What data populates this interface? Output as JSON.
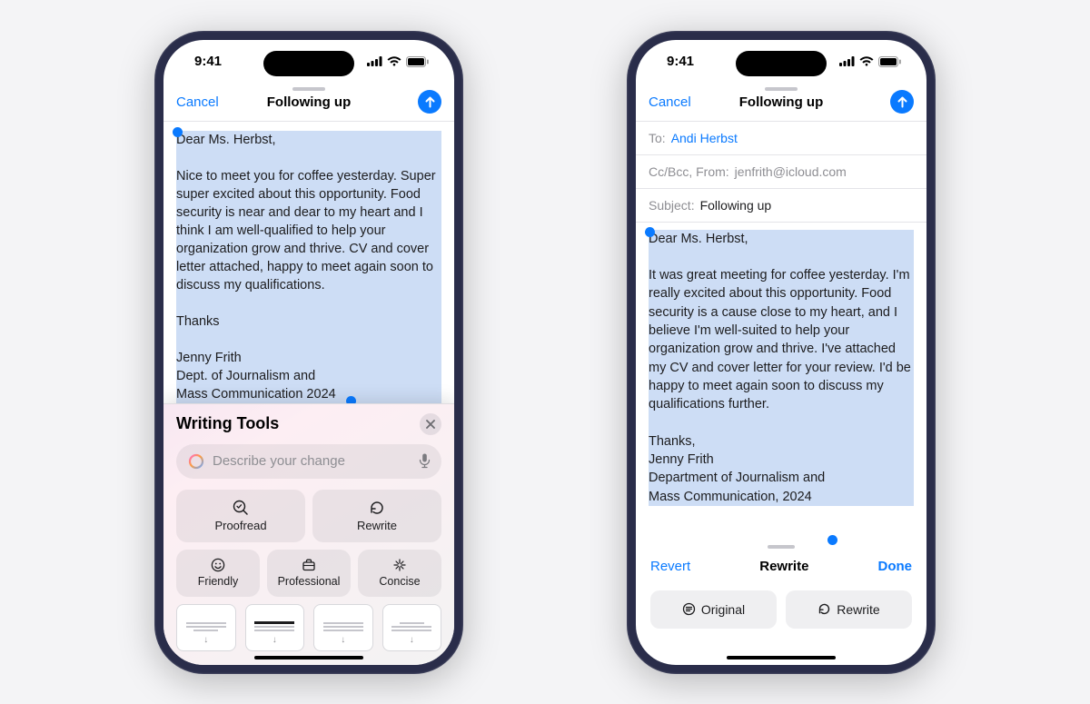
{
  "status": {
    "time": "9:41"
  },
  "nav": {
    "cancel": "Cancel",
    "title": "Following up"
  },
  "phone1": {
    "body": "Dear Ms. Herbst,\n\nNice to meet you for coffee yesterday. Super super excited about this opportunity. Food security is near and dear to my heart and I think I am well-qualified to help your organization grow and thrive. CV and cover letter attached, happy to meet again soon to discuss my qualifications.\n\nThanks\n\nJenny Frith\nDept. of Journalism and\nMass Communication 2024"
  },
  "wt": {
    "title": "Writing Tools",
    "placeholder": "Describe your change",
    "proofread": "Proofread",
    "rewrite": "Rewrite",
    "friendly": "Friendly",
    "professional": "Professional",
    "concise": "Concise"
  },
  "phone2": {
    "to_label": "To:",
    "to_value": "Andi Herbst",
    "ccbcc_label": "Cc/Bcc, From:",
    "ccbcc_value": "jenfrith@icloud.com",
    "subject_label": "Subject:",
    "subject_value": "Following up",
    "body": "Dear Ms. Herbst,\n\nIt was great meeting for coffee yesterday. I'm really excited about this opportunity. Food security is a cause close to my heart, and I believe I'm well-suited to help your organization grow and thrive. I've attached my CV and cover letter for your review. I'd be happy to meet again soon to discuss my qualifications further.\n\nThanks,\nJenny Frith\nDepartment of Journalism and\nMass Communication, 2024",
    "revert": "Revert",
    "mode": "Rewrite",
    "done": "Done",
    "original": "Original",
    "rewrite_btn": "Rewrite"
  }
}
